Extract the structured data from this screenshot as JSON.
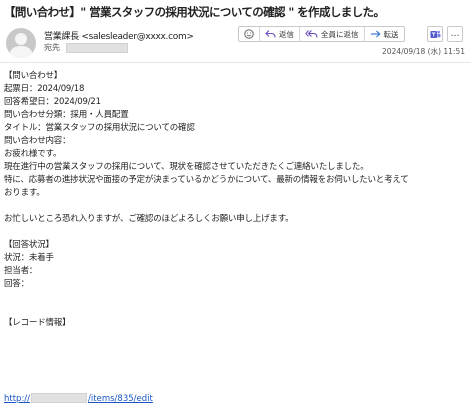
{
  "message": {
    "subject": "【問い合わせ】\" 営業スタッフの採用状況についての確認 \" を作成しました。",
    "sender_display": "営業課長 <salesleader@xxxx.com>",
    "to_label": "宛先",
    "date": "2024/09/18 (水) 11:51"
  },
  "toolbar": {
    "reply_label": "返信",
    "reply_all_label": "全員に返信",
    "forward_label": "転送"
  },
  "icons": {
    "emoji": "emoji-icon",
    "reply": "reply-icon",
    "reply_all": "reply-all-icon",
    "forward": "forward-icon",
    "teams": "teams-icon",
    "more": "more-icon"
  },
  "body": {
    "lines": [
      "【問い合わせ】",
      "起票日：2024/09/18",
      "回答希望日：2024/09/21",
      "問い合わせ分類：採用・人員配置",
      "タイトル：営業スタッフの採用状況についての確認",
      "問い合わせ内容：",
      "お疲れ様です。",
      "現在進行中の営業スタッフの採用について、現状を確認させていただきたくご連絡いたしました。",
      "特に、応募者の進捗状況や面接の予定が決まっているかどうかについて、最新の情報をお伺いしたいと考えて",
      "おります。",
      "",
      "お忙しいところ恐れ入りますが、ご確認のほどよろしくお願い申し上げます。",
      "",
      "【回答状況】",
      "状況：未着手",
      "担当者：",
      "回答：",
      "",
      "",
      "【レコード情報】"
    ],
    "link_prefix": "http://",
    "link_suffix": "/items/835/edit"
  },
  "colors": {
    "link": "#1a55c4",
    "reply_purple": "#6b4fbb",
    "forward_blue": "#2f6fd0",
    "teams_purple": "#5059c9"
  }
}
